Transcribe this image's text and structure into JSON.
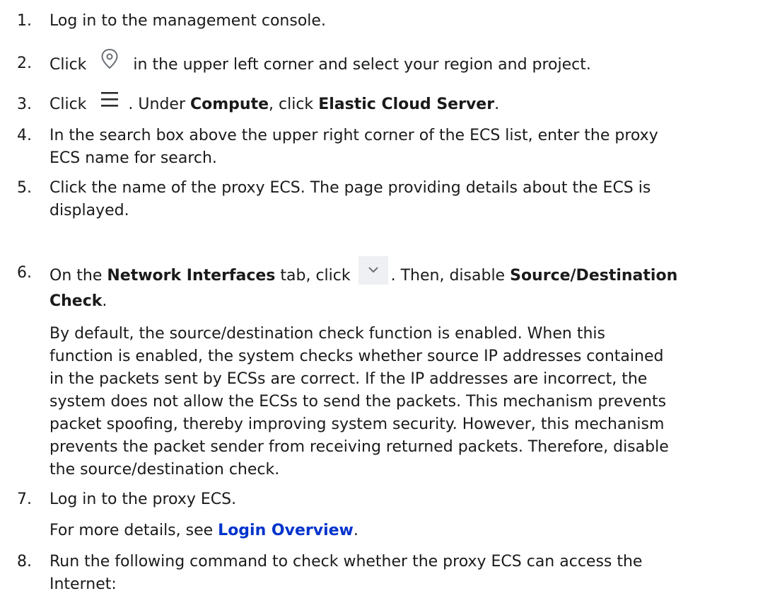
{
  "steps": [
    {
      "num": "1.",
      "text": "Log in to the management console."
    },
    {
      "num": "2.",
      "pre": "Click",
      "post": "in the upper left corner and select your region and project.",
      "icon": "location-pin-icon"
    },
    {
      "num": "3.",
      "pre": "Click",
      "mid1": ". Under",
      "b1": "Compute",
      "mid2": ", click",
      "b2": "Elastic Cloud Server",
      "end": ".",
      "icon": "hamburger-menu-icon"
    },
    {
      "num": "4.",
      "line1": "In the search box above the upper right corner of the ECS list, enter the proxy",
      "line2": "ECS name for search."
    },
    {
      "num": "5.",
      "line1": "Click the name of the proxy ECS. The page providing details about the ECS is",
      "line2": "displayed."
    },
    {
      "num": "6.",
      "pre": "On the",
      "b1": "Network Interfaces",
      "mid1": "tab, click",
      "mid2": ". Then, disable",
      "b2": "Source/Destination",
      "b3": "Check",
      "end": ".",
      "icon": "chevron-down-icon",
      "para": [
        "By default, the source/destination check function is enabled. When this",
        "function is enabled, the system checks whether source IP addresses contained",
        "in the packets sent by ECSs are correct. If the IP addresses are incorrect, the",
        "system does not allow the ECSs to send the packets. This mechanism prevents",
        "packet spoofing, thereby improving system security. However, this mechanism",
        "prevents the packet sender from receiving returned packets. Therefore, disable",
        "the source/destination check."
      ]
    },
    {
      "num": "7.",
      "text": "Log in to the proxy ECS.",
      "sub_pre": "For more details, see",
      "link": "Login Overview",
      "sub_end": "."
    },
    {
      "num": "8.",
      "line1": "Run the following command to check whether the proxy ECS can access the",
      "line2": "Internet:"
    }
  ],
  "colors": {
    "link": "#0033cc",
    "text": "#1a1a1a"
  }
}
